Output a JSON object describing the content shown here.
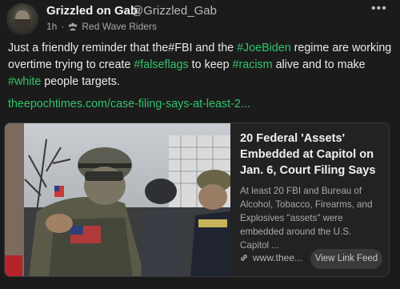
{
  "post": {
    "author_name": "Grizzled on Gab",
    "author_handle": "@Grizzled_Gab",
    "time": "1h",
    "separator": "·",
    "group_name": "Red Wave Riders",
    "more_icon": "more-horizontal-icon",
    "text": {
      "part1": "Just a friendly reminder that the#FBI and the ",
      "tag1": "#JoeBiden",
      "part2": " regime are working overtime trying to create ",
      "tag2": "#falseflags",
      "part3": " to keep ",
      "tag3": "#racism",
      "part4": " alive and to make ",
      "tag4": "#white",
      "part5": " people targets."
    },
    "link": "theepochtimes.com/case-filing-says-at-least-2..."
  },
  "card": {
    "title": "20 Federal 'Assets' Embedded at Capitol on Jan. 6, Court Filing Says",
    "description": "At least 20 FBI and Bureau of Alcohol, Tobacco, Firearms, and Explosives \"assets\" were embedded around the U.S. Capitol ...",
    "domain": "www.thee...",
    "button": "View Link Feed"
  },
  "colors": {
    "background": "#1b1b1b",
    "accent_green": "#33c36b",
    "card_border": "#383838"
  }
}
